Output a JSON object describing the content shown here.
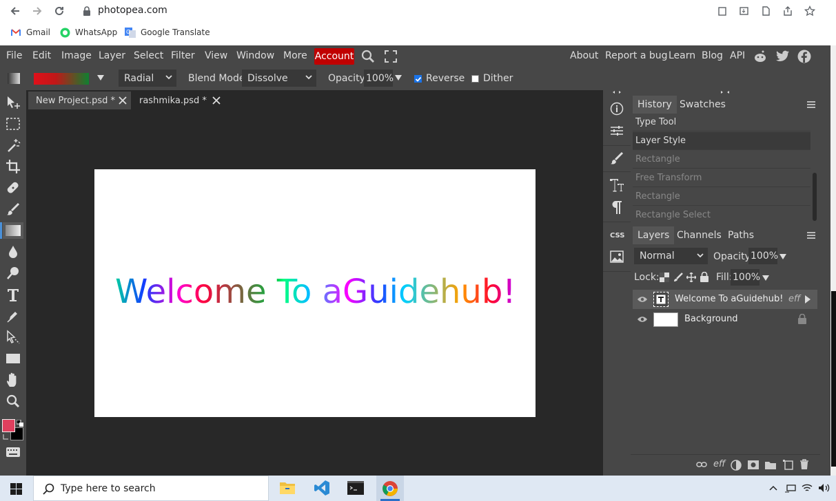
{
  "browser": {
    "url": "photopea.com",
    "bookmarks": [
      {
        "label": "Gmail",
        "icon": "gmail-icon"
      },
      {
        "label": "WhatsApp",
        "icon": "whatsapp-icon"
      },
      {
        "label": "Google Translate",
        "icon": "google-translate-icon"
      }
    ]
  },
  "menubar": {
    "items": [
      "File",
      "Edit",
      "Image",
      "Layer",
      "Select",
      "Filter",
      "View",
      "Window",
      "More"
    ],
    "account": "Account",
    "right_links": [
      "About",
      "Report a bug",
      "Learn",
      "Blog",
      "API"
    ],
    "accent": "#c00000"
  },
  "options": {
    "gradient_type": "Radial",
    "blend_mode_label": "Blend Mode:",
    "blend_mode": "Dissolve",
    "opacity_label": "Opacity:",
    "opacity": "100%",
    "reverse_label": "Reverse",
    "reverse_checked": true,
    "dither_label": "Dither",
    "dither_checked": false
  },
  "tabs": [
    {
      "label": "New Project.psd *",
      "active": true
    },
    {
      "label": "rashmika.psd *",
      "active": false
    }
  ],
  "canvas": {
    "text": "Welcome To aGuidehub!"
  },
  "history": {
    "tabs": [
      "History",
      "Swatches"
    ],
    "items": [
      "Type Tool",
      "Layer Style",
      "Rectangle",
      "Free Transform",
      "Rectangle",
      "Rectangle Select"
    ]
  },
  "layers": {
    "tabs": [
      "Layers",
      "Channels",
      "Paths"
    ],
    "blend": "Normal",
    "opacity_label": "Opacity:",
    "opacity": "100%",
    "lock_label": "Lock:",
    "fill_label": "Fill:",
    "fill": "100%",
    "items": [
      {
        "name": "Welcome To aGuidehub!",
        "type": "text",
        "fx": "eff"
      },
      {
        "name": "Background",
        "type": "background"
      }
    ]
  },
  "taskbar": {
    "search_placeholder": "Type here to search"
  }
}
